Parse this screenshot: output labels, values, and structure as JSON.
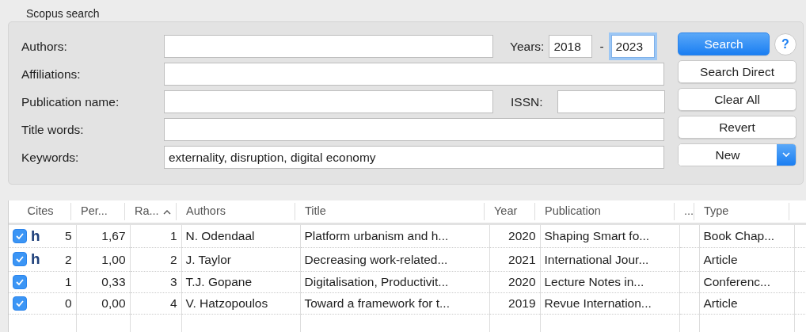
{
  "group_title": "Scopus search",
  "fields": [
    {
      "label": "Authors:",
      "years": {
        "label": "Years:",
        "from": "2018",
        "separator": "-",
        "to": "2023",
        "to_focused": true
      }
    },
    {
      "label": "Affiliations:"
    },
    {
      "label": "Publication name:",
      "issn": {
        "label": "ISSN:"
      }
    },
    {
      "label": "Title words:"
    },
    {
      "label": "Keywords:",
      "value": "externality, disruption, digital economy"
    }
  ],
  "buttons": [
    {
      "label": "Search",
      "kind": "default"
    },
    {
      "label": "Search Direct",
      "kind": "plain"
    },
    {
      "label": "Clear All",
      "kind": "plain"
    },
    {
      "label": "Revert",
      "kind": "plain"
    },
    {
      "label": "New",
      "kind": "split"
    }
  ],
  "help": "?",
  "table": {
    "columns": [
      {
        "label": "Cites",
        "sorted": false
      },
      {
        "label": "Per...",
        "sorted": false
      },
      {
        "label": "Ra...",
        "sorted": true
      },
      {
        "label": "Authors",
        "sorted": false
      },
      {
        "label": "Title",
        "sorted": false
      },
      {
        "label": "Year",
        "sorted": false
      },
      {
        "label": "Publication",
        "sorted": false
      },
      {
        "label": "...",
        "sorted": false
      },
      {
        "label": "Type",
        "sorted": false
      }
    ],
    "rows": [
      {
        "checked": true,
        "h_index": "h",
        "cites": "5",
        "per": "1,67",
        "rank": "1",
        "authors": "N. Odendaal",
        "title": "Platform urbanism and h...",
        "year": "2020",
        "publication": "Shaping Smart fo...",
        "type": "Book Chap..."
      },
      {
        "checked": true,
        "h_index": "h",
        "cites": "2",
        "per": "1,00",
        "rank": "2",
        "authors": "J. Taylor",
        "title": "Decreasing work-related...",
        "year": "2021",
        "publication": "International Jour...",
        "type": "Article"
      },
      {
        "checked": true,
        "cites": "1",
        "per": "0,33",
        "rank": "3",
        "authors": "T.J. Gopane",
        "title": "Digitalisation, Productivit...",
        "year": "2020",
        "publication": "Lecture Notes in...",
        "type": "Conferenc..."
      },
      {
        "checked": true,
        "cites": "0",
        "per": "0,00",
        "rank": "4",
        "authors": "V. Hatzopoulos",
        "title": "Toward a framework for t...",
        "year": "2019",
        "publication": "Revue Internation...",
        "type": "Article"
      }
    ]
  }
}
